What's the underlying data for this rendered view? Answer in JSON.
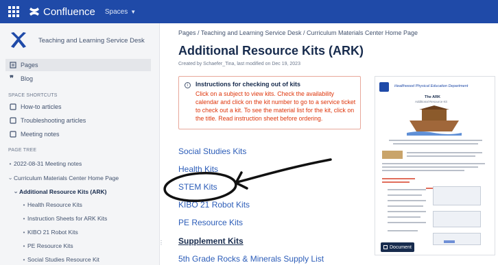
{
  "topbar": {
    "app_name": "Confluence",
    "spaces_label": "Spaces",
    "icons": [
      "app-switcher-icon",
      "confluence-logo-icon",
      "chevron-down-icon"
    ]
  },
  "sidebar": {
    "space_name": "Teaching and Learning Service Desk",
    "nav": [
      {
        "label": "Pages",
        "icon": "pages-icon"
      },
      {
        "label": "Blog",
        "icon": "quote-icon"
      }
    ],
    "shortcuts_heading": "SPACE SHORTCUTS",
    "shortcuts": [
      {
        "label": "How-to articles",
        "icon": "shortcut-icon"
      },
      {
        "label": "Troubleshooting articles",
        "icon": "shortcut-icon"
      },
      {
        "label": "Meeting notes",
        "icon": "shortcut-icon"
      }
    ],
    "tree_heading": "PAGE TREE",
    "tree": [
      {
        "label": "2022-08-31 Meeting notes",
        "bullet": "•"
      },
      {
        "label": "Curriculum Materials Center Home Page",
        "bullet": "⌄"
      },
      {
        "label": "Additional Resource Kits (ARK)",
        "bullet": "⌄"
      },
      {
        "label": "Health Resource Kits",
        "bullet": "•"
      },
      {
        "label": "Instruction Sheets for ARK Kits",
        "bullet": "•"
      },
      {
        "label": "KIBO 21 Robot Kits",
        "bullet": "•"
      },
      {
        "label": "PE Resource Kits",
        "bullet": "•"
      },
      {
        "label": "Social Studies Resource Kit",
        "bullet": "•"
      }
    ]
  },
  "main": {
    "breadcrumb": "Pages / Teaching and Learning Service Desk / Curriculum Materials Center Home Page",
    "title": "Additional Resource Kits (ARK)",
    "byline": "Created by Schaefer_Tina, last modified on Dec 19, 2023",
    "info": {
      "title": "Instructions for checking out of kits",
      "body": "Click on a subject to view kits. Check the availability calendar and click on the kit number to go to a service ticket to check out a kit. To see the material list for the kit, click on the title. Read instruction sheet before ordering."
    },
    "links": [
      {
        "label": "Social Studies Kits"
      },
      {
        "label": "Health Kits"
      },
      {
        "label": "STEM Kits"
      },
      {
        "label": "KIBO 21 Robot Kits"
      },
      {
        "label": "PE Resource Kits"
      },
      {
        "label": "Supplement Kits"
      },
      {
        "label": "5th Grade Rocks & Minerals Supply List"
      }
    ],
    "document": {
      "header": "Healthwood Physical Education Department",
      "subtitle": "The ARK",
      "subtitle2": "Additional Resource Kit",
      "badge": "Document"
    }
  },
  "colors": {
    "topbar": "#1f4aa8",
    "link": "#2b5cb8",
    "info_text": "#de350b",
    "info_border": "#e8a79a"
  }
}
